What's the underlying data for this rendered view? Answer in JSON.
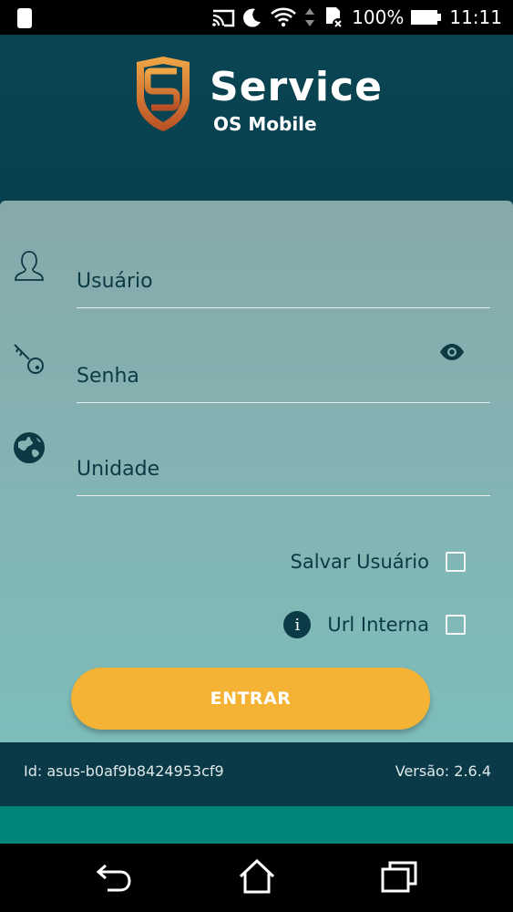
{
  "status_bar": {
    "battery": "100%",
    "time": "11:11",
    "icons": [
      "phone-icon",
      "cast-icon",
      "moon-icon",
      "wifi-icon",
      "data-arrows-icon",
      "sd-card-icon",
      "battery-icon"
    ]
  },
  "header": {
    "title": "Service",
    "subtitle": "OS Mobile",
    "colors": {
      "shield_top": "#f0a646",
      "shield_bottom": "#b84f24"
    }
  },
  "form": {
    "username": {
      "placeholder": "Usuário",
      "value": ""
    },
    "password": {
      "placeholder": "Senha",
      "value": ""
    },
    "unit": {
      "placeholder": "Unidade",
      "value": ""
    },
    "save_user_label": "Salvar Usuário",
    "internal_url_label": "Url Interna",
    "info_symbol": "i",
    "submit_label": "ENTRAR"
  },
  "footer": {
    "id_text": "Id: asus-b0af9b8424953cf9",
    "version_text": "Versão: 2.6.4"
  },
  "navigation": {
    "icons": [
      "back-icon",
      "home-icon",
      "recents-icon"
    ]
  },
  "colors": {
    "accent": "#f5b335",
    "card": "#83b3b3",
    "dark": "#0a3a47",
    "teal": "#01867a"
  }
}
